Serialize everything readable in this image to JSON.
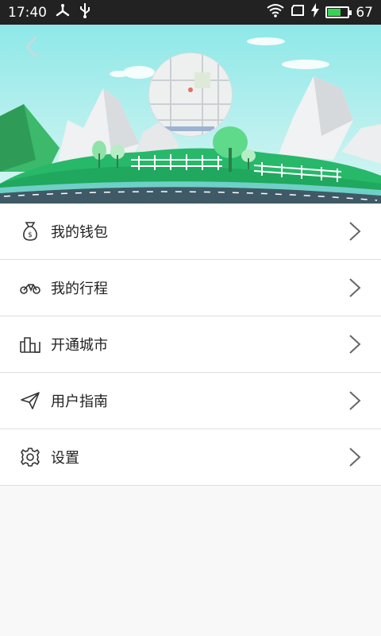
{
  "status_bar": {
    "time": "17:40",
    "battery": "67",
    "battery_level": 0.67,
    "icons": [
      "network-icon",
      "usb-icon",
      "wifi-icon",
      "sim-icon",
      "charging-icon",
      "battery-icon"
    ]
  },
  "header": {
    "back_icon": "chevron-left-icon",
    "illustration": "city-map-landscape"
  },
  "menu": {
    "items": [
      {
        "label": "我的钱包",
        "icon": "wallet-icon"
      },
      {
        "label": "我的行程",
        "icon": "bike-icon"
      },
      {
        "label": "开通城市",
        "icon": "city-icon"
      },
      {
        "label": "用户指南",
        "icon": "paper-plane-icon"
      },
      {
        "label": "设置",
        "icon": "gear-icon"
      }
    ]
  },
  "colors": {
    "status_bar_bg": "#222222",
    "sky": "#8ee0e3",
    "grass": "#2cb86e",
    "road": "#3f5a66",
    "list_bg": "#ffffff",
    "page_bg": "#f8f8f8"
  }
}
